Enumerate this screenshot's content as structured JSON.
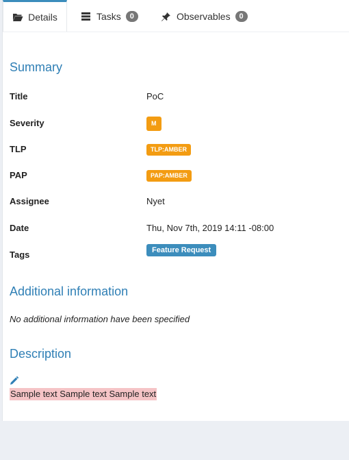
{
  "tabs": [
    {
      "label": "Details",
      "icon": "folder-open-icon",
      "active": true
    },
    {
      "label": "Tasks",
      "icon": "tasks-icon",
      "count": "0"
    },
    {
      "label": "Observables",
      "icon": "pin-icon",
      "count": "0"
    }
  ],
  "summary": {
    "heading": "Summary",
    "title_label": "Title",
    "title_value": "PoC",
    "severity_label": "Severity",
    "severity_value": "M",
    "tlp_label": "TLP",
    "tlp_value": "TLP:AMBER",
    "pap_label": "PAP",
    "pap_value": "PAP:AMBER",
    "assignee_label": "Assignee",
    "assignee_value": "Nyet",
    "date_label": "Date",
    "date_value": "Thu, Nov 7th, 2019 14:11 -08:00",
    "tags_label": "Tags",
    "tags": [
      "Feature Request"
    ]
  },
  "additional": {
    "heading": "Additional information",
    "note": "No additional information have been specified"
  },
  "description": {
    "heading": "Description",
    "text": "Sample text Sample text Sample text"
  },
  "colors": {
    "accent": "#2f7fb5",
    "amber": "#f39c12",
    "tag": "#3c8dbc",
    "highlight": "#f5c4c6"
  }
}
